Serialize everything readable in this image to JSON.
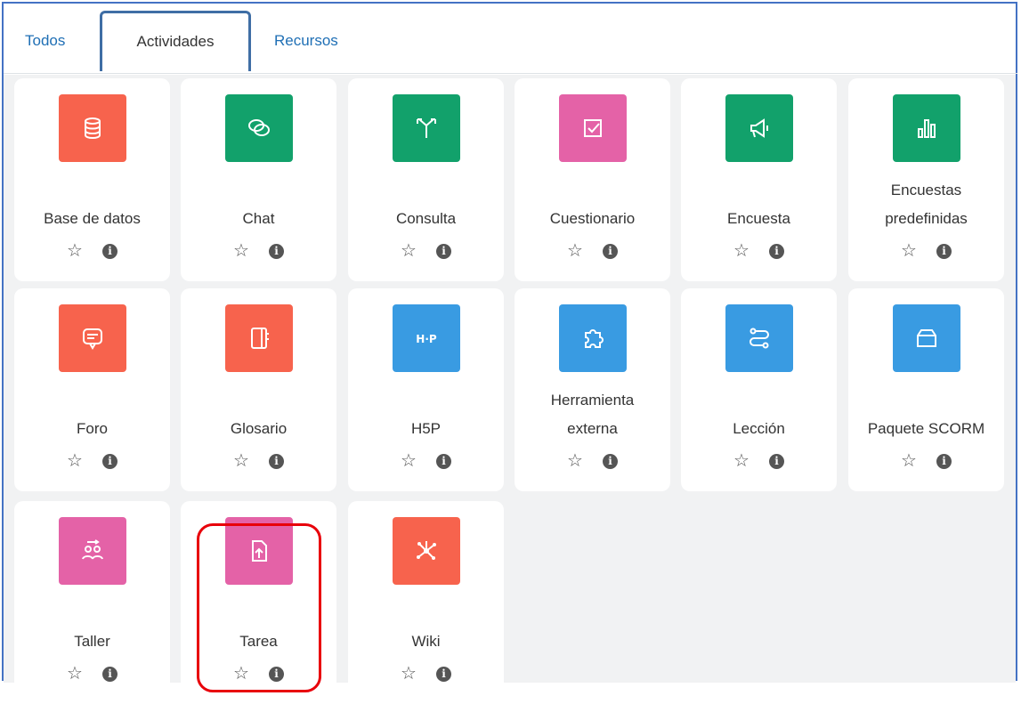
{
  "tabs": [
    {
      "label": "Todos"
    },
    {
      "label": "Actividades"
    },
    {
      "label": "Recursos"
    }
  ],
  "activities": [
    {
      "name": "Base de datos",
      "icon": "database-icon",
      "color": "#f7634d"
    },
    {
      "name": "Chat",
      "icon": "chat-icon",
      "color": "#12a16b"
    },
    {
      "name": "Consulta",
      "icon": "choice-icon",
      "color": "#12a16b"
    },
    {
      "name": "Cuestionario",
      "icon": "quiz-icon",
      "color": "#e462a7"
    },
    {
      "name": "Encuesta",
      "icon": "feedback-icon",
      "color": "#12a16b"
    },
    {
      "name": "Encuestas predefinidas",
      "icon": "survey-icon",
      "color": "#12a16b"
    },
    {
      "name": "Foro",
      "icon": "forum-icon",
      "color": "#f7634d"
    },
    {
      "name": "Glosario",
      "icon": "glossary-icon",
      "color": "#f7634d"
    },
    {
      "name": "H5P",
      "icon": "h5p-icon",
      "color": "#399be2"
    },
    {
      "name": "Herramienta externa",
      "icon": "puzzle-icon",
      "color": "#399be2"
    },
    {
      "name": "Lección",
      "icon": "lesson-icon",
      "color": "#399be2"
    },
    {
      "name": "Paquete SCORM",
      "icon": "scorm-icon",
      "color": "#399be2"
    },
    {
      "name": "Taller",
      "icon": "workshop-icon",
      "color": "#e462a7"
    },
    {
      "name": "Tarea",
      "icon": "assignment-icon",
      "color": "#e462a7"
    },
    {
      "name": "Wiki",
      "icon": "wiki-icon",
      "color": "#f7634d"
    }
  ],
  "actions": {
    "star": "☆",
    "info": "i"
  },
  "colors": {
    "tab_link": "#1f6fb5",
    "highlight": "#e8000a",
    "frame": "#4472c4"
  }
}
